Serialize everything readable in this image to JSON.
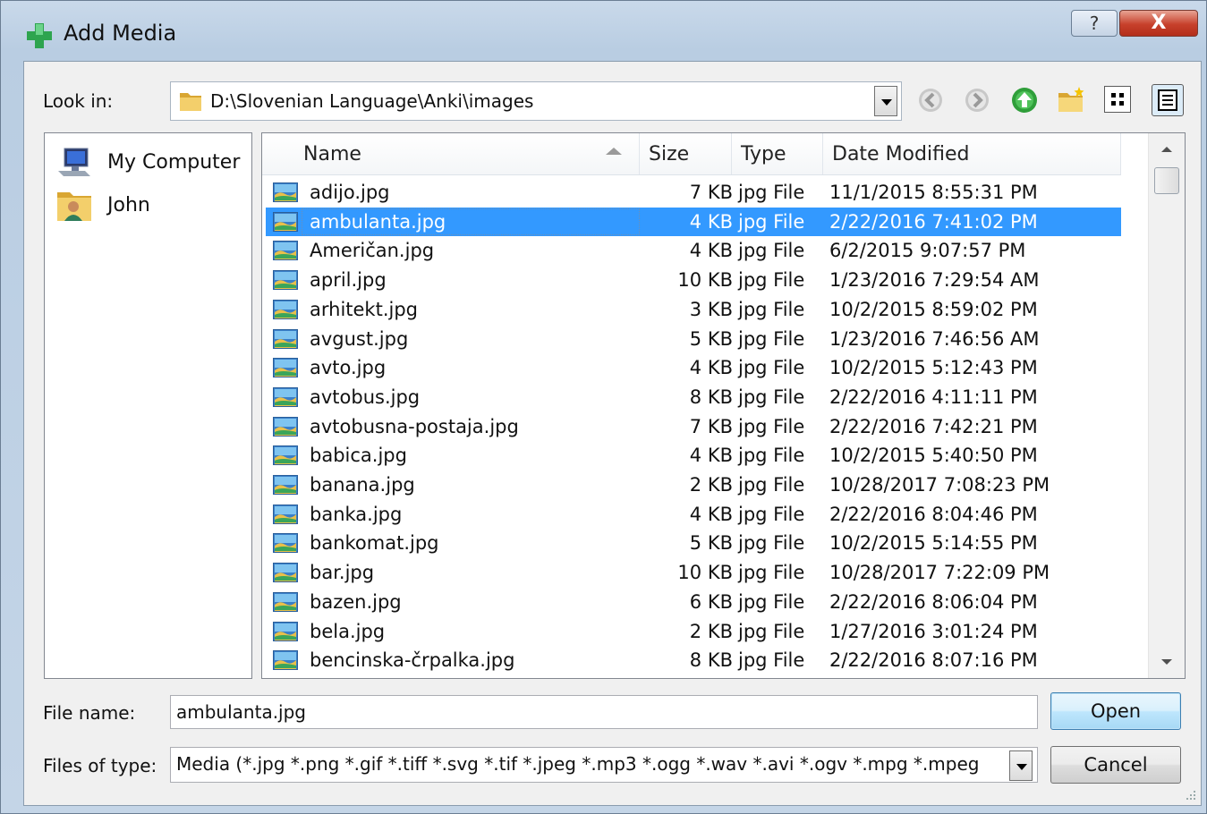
{
  "window": {
    "title": "Add Media",
    "help_label": "?",
    "close_label": "X"
  },
  "toolbar": {
    "look_in_label": "Look in:",
    "look_in_path": "D:\\Slovenian Language\\Anki\\images",
    "icons": [
      "back-icon",
      "forward-icon",
      "up-folder-icon",
      "new-folder-icon",
      "list-view-icon",
      "detail-view-icon"
    ]
  },
  "sidebar": {
    "items": [
      {
        "label": "My Computer",
        "icon": "computer-icon"
      },
      {
        "label": "John",
        "icon": "user-folder-icon"
      }
    ]
  },
  "file_list": {
    "columns": [
      "Name",
      "Size",
      "Type",
      "Date Modified"
    ],
    "sort_column": "Name",
    "selected_index": 1,
    "rows": [
      {
        "name": "adijo.jpg",
        "size": "7 KB",
        "type": "jpg File",
        "date": "11/1/2015 8:55:31 PM"
      },
      {
        "name": "ambulanta.jpg",
        "size": "4 KB",
        "type": "jpg File",
        "date": "2/22/2016 7:41:02 PM"
      },
      {
        "name": "Američan.jpg",
        "size": "4 KB",
        "type": "jpg File",
        "date": "6/2/2015 9:07:57 PM"
      },
      {
        "name": "april.jpg",
        "size": "10 KB",
        "type": "jpg File",
        "date": "1/23/2016 7:29:54 AM"
      },
      {
        "name": "arhitekt.jpg",
        "size": "3 KB",
        "type": "jpg File",
        "date": "10/2/2015 8:59:02 PM"
      },
      {
        "name": "avgust.jpg",
        "size": "5 KB",
        "type": "jpg File",
        "date": "1/23/2016 7:46:56 AM"
      },
      {
        "name": "avto.jpg",
        "size": "4 KB",
        "type": "jpg File",
        "date": "10/2/2015 5:12:43 PM"
      },
      {
        "name": "avtobus.jpg",
        "size": "8 KB",
        "type": "jpg File",
        "date": "2/22/2016 4:11:11 PM"
      },
      {
        "name": "avtobusna-postaja.jpg",
        "size": "7 KB",
        "type": "jpg File",
        "date": "2/22/2016 7:42:21 PM"
      },
      {
        "name": "babica.jpg",
        "size": "4 KB",
        "type": "jpg File",
        "date": "10/2/2015 5:40:50 PM"
      },
      {
        "name": "banana.jpg",
        "size": "2 KB",
        "type": "jpg File",
        "date": "10/28/2017 7:08:23 PM"
      },
      {
        "name": "banka.jpg",
        "size": "4 KB",
        "type": "jpg File",
        "date": "2/22/2016 8:04:46 PM"
      },
      {
        "name": "bankomat.jpg",
        "size": "5 KB",
        "type": "jpg File",
        "date": "10/2/2015 5:14:55 PM"
      },
      {
        "name": "bar.jpg",
        "size": "10 KB",
        "type": "jpg File",
        "date": "10/28/2017 7:22:09 PM"
      },
      {
        "name": "bazen.jpg",
        "size": "6 KB",
        "type": "jpg File",
        "date": "2/22/2016 8:06:04 PM"
      },
      {
        "name": "bela.jpg",
        "size": "2 KB",
        "type": "jpg File",
        "date": "1/27/2016 3:01:24 PM"
      },
      {
        "name": "bencinska-črpalka.jpg",
        "size": "8 KB",
        "type": "jpg File",
        "date": "2/22/2016 8:07:16 PM"
      }
    ]
  },
  "bottom": {
    "file_name_label": "File name:",
    "file_name_value": "ambulanta.jpg",
    "files_of_type_label": "Files of type:",
    "files_of_type_value": "Media (*.jpg *.png *.gif *.tiff *.svg *.tif *.jpeg *.mp3 *.ogg *.wav *.avi *.ogv *.mpg *.mpeg",
    "open_label": "Open",
    "cancel_label": "Cancel"
  },
  "colors": {
    "selection": "#3399ff",
    "close_button": "#c7402b",
    "accent_green": "#2ea44f"
  }
}
